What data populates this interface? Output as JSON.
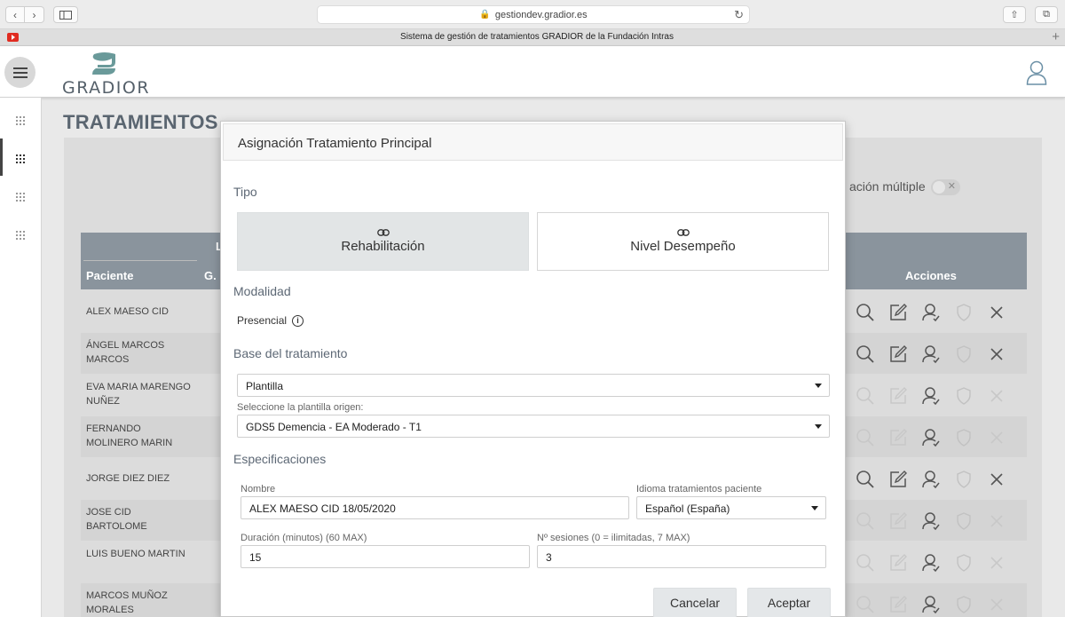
{
  "browser": {
    "url": "gestiondev.gradior.es",
    "tab_title": "Sistema de gestión de tratamientos GRADIOR de la Fundación Intras"
  },
  "header": {
    "logo_text": "GRADIOR"
  },
  "page": {
    "title": "TRATAMIENTOS",
    "multi_label": "ación múltiple",
    "table_group_label": "L",
    "columns": [
      "Paciente",
      "G.",
      "Acciones"
    ],
    "rows": [
      {
        "name": "ALEX MAESO CID",
        "active": true
      },
      {
        "name": "ÁNGEL MARCOS MARCOS",
        "active": true
      },
      {
        "name": "EVA MARIA MARENGO NUÑEZ",
        "active": false
      },
      {
        "name": "FERNANDO MOLINERO MARIN",
        "active": false
      },
      {
        "name": "JORGE DIEZ DIEZ",
        "active": true
      },
      {
        "name": "JOSE CID BARTOLOME",
        "active": false
      },
      {
        "name": "LUIS BUENO MARTIN",
        "active": false
      },
      {
        "name": "MARCOS MUÑOZ MORALES",
        "active": false
      }
    ]
  },
  "modal": {
    "title": "Asignación Tratamiento Principal",
    "tipo_label": "Tipo",
    "tipo_options": [
      "Rehabilitación",
      "Nivel Desempeño"
    ],
    "modalidad_label": "Modalidad",
    "modalidad_value": "Presencial",
    "base_label": "Base del tratamiento",
    "base_value": "Plantilla",
    "plantilla_label": "Seleccione la plantilla origen:",
    "plantilla_value": "GDS5 Demencia - EA Moderado - T1",
    "especificaciones_label": "Especificaciones",
    "nombre_label": "Nombre",
    "nombre_value": "ALEX MAESO CID 18/05/2020",
    "idioma_label": "Idioma tratamientos paciente",
    "idioma_value": "Español (España)",
    "duracion_label": "Duración (minutos) (60 MAX)",
    "duracion_value": "15",
    "sesiones_label": "Nº sesiones (0 = ilimitadas, 7 MAX)",
    "sesiones_value": "3",
    "cancel_label": "Cancelar",
    "accept_label": "Aceptar"
  },
  "colors": {
    "brand": "#6a9a9a",
    "table_header": "#8a949d"
  }
}
